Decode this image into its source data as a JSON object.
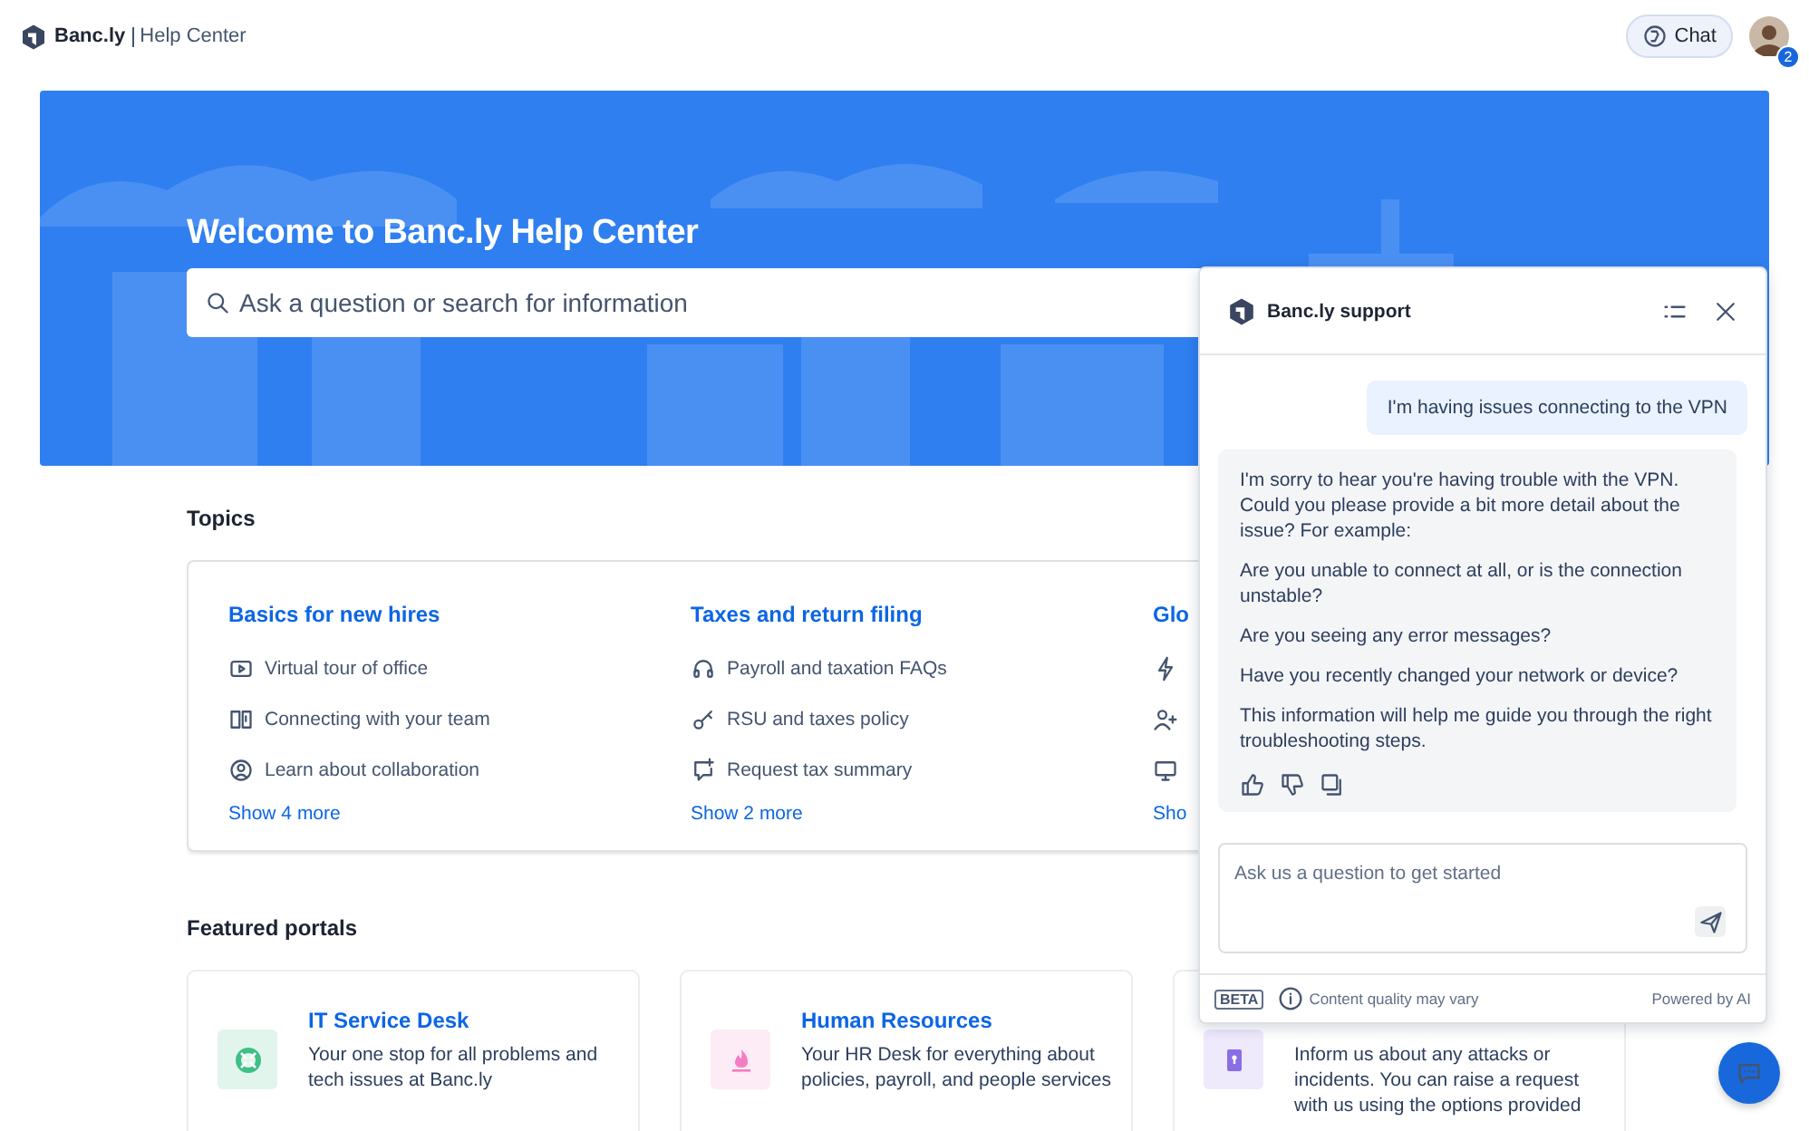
{
  "header": {
    "brand": "Banc.ly",
    "section": "Help Center",
    "chat_button": "Chat",
    "notification_count": "2"
  },
  "hero": {
    "title": "Welcome to Banc.ly Help Center",
    "search": {
      "placeholder": "Ask a question or search for information"
    }
  },
  "topics": {
    "heading": "Topics",
    "groups": [
      {
        "title": "Basics for new hires",
        "items": [
          {
            "kind": "labelled",
            "label": "Virtual tour of office"
          },
          {
            "kind": "labelled",
            "label": "Connecting with your team"
          },
          {
            "kind": "labelled",
            "label": "Learn about collaboration"
          }
        ],
        "more": "Show 4 more"
      },
      {
        "title": "Taxes and return filing",
        "items": [
          {
            "kind": "labelled",
            "label": "Payroll and taxation FAQs"
          },
          {
            "kind": "labelled",
            "label": "RSU and taxes policy"
          },
          {
            "kind": "labelled",
            "label": "Request tax summary"
          }
        ],
        "more": "Show 2 more"
      },
      {
        "title": "Glo",
        "items": [
          {
            "kind": "icon-only"
          },
          {
            "kind": "icon-only"
          },
          {
            "kind": "icon-only"
          }
        ],
        "more": "Sho"
      }
    ]
  },
  "portals": {
    "heading": "Featured portals",
    "cards": [
      {
        "title": "IT Service Desk",
        "description": "Your one stop for all problems and tech issues at Banc.ly",
        "color": "#3fbf86"
      },
      {
        "title": "Human Resources",
        "description": "Your HR Desk for everything about policies, payroll, and people services",
        "color": "#f47cc1"
      },
      {
        "description": "Inform us about any attacks or incidents. You can raise a request with us using the options provided",
        "color": "#8a6ee6"
      }
    ]
  },
  "chat": {
    "title": "Banc.ly support",
    "messages": [
      {
        "kind": "user",
        "paragraphs": [
          "I'm having issues connecting to the VPN"
        ]
      },
      {
        "kind": "bot",
        "paragraphs": [
          "I'm sorry to hear you're having trouble with the VPN. Could you please provide a bit more detail about the issue? For example:",
          "Are you unable to connect at all, or is the connection unstable?",
          "Are you seeing any error messages?",
          "Have you recently changed your network or device?",
          "This information will help me guide you through the right troubleshooting steps."
        ]
      }
    ],
    "input": {
      "placeholder": "Ask us a question to get started"
    },
    "badge": "BETA",
    "notice": "Content quality may vary",
    "footer": "Powered by AI"
  }
}
